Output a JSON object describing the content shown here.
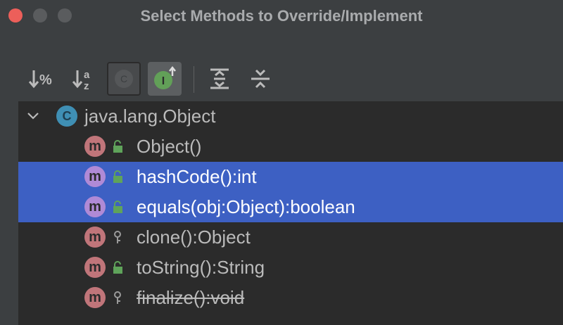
{
  "window": {
    "title": "Select Methods to Override/Implement"
  },
  "toolbar": {
    "buttons": [
      {
        "name": "sort-by-visibility",
        "icon": "sort-visibility-icon"
      },
      {
        "name": "sort-alphabetically",
        "icon": "sort-alpha-icon"
      },
      {
        "name": "show-classes",
        "icon": "class-icon"
      },
      {
        "name": "show-interfaces",
        "icon": "interface-icon"
      },
      {
        "name": "expand-all",
        "icon": "expand-all-icon"
      },
      {
        "name": "collapse-all",
        "icon": "collapse-all-icon"
      }
    ]
  },
  "tree": {
    "root": {
      "label": "java.lang.Object",
      "badge": "C",
      "expanded": true
    },
    "methods": [
      {
        "label": "Object()",
        "badge": "m",
        "visibility": "public",
        "selected": false,
        "deprecated": false
      },
      {
        "label": "hashCode():int",
        "badge": "m",
        "visibility": "public",
        "selected": true,
        "deprecated": false
      },
      {
        "label": "equals(obj:Object):boolean",
        "badge": "m",
        "visibility": "public",
        "selected": true,
        "deprecated": false
      },
      {
        "label": "clone():Object",
        "badge": "m",
        "visibility": "protected",
        "selected": false,
        "deprecated": false
      },
      {
        "label": "toString():String",
        "badge": "m",
        "visibility": "public",
        "selected": false,
        "deprecated": false
      },
      {
        "label": "finalize():void",
        "badge": "m",
        "visibility": "protected",
        "selected": false,
        "deprecated": true
      }
    ]
  },
  "colors": {
    "selection": "#3d60c3",
    "method_badge": "#c0757a",
    "method_badge_selected": "#b08ad6",
    "class_badge": "#3f8fb4",
    "public_lock": "#5fa35a"
  }
}
